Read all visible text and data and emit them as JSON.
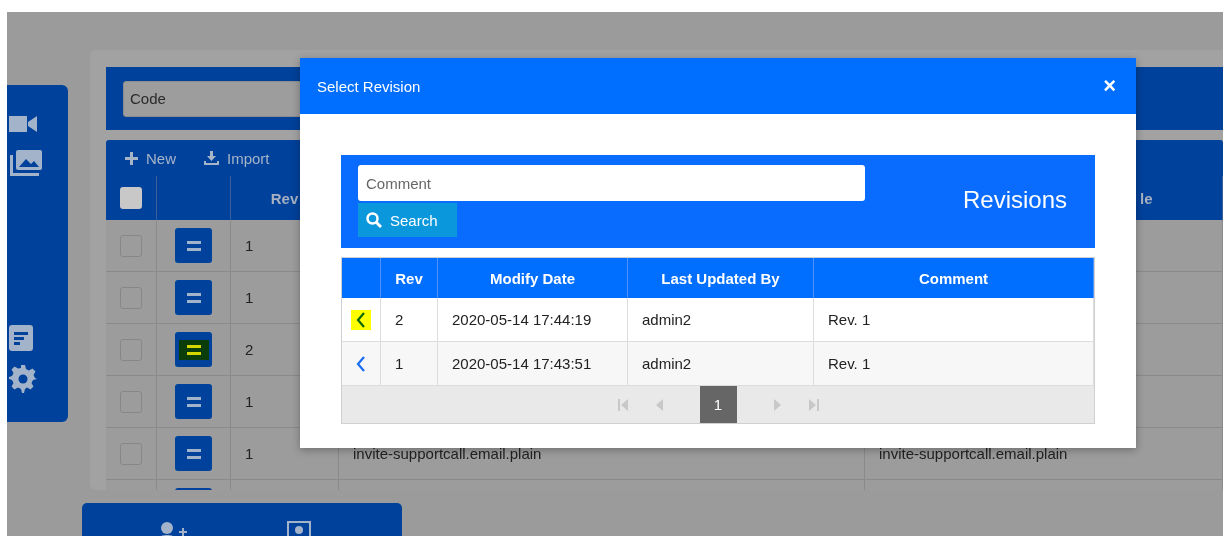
{
  "filter": {
    "code_placeholder": "Code"
  },
  "toolbar": {
    "buttons": [
      {
        "label": "New",
        "kind": "new"
      },
      {
        "label": "Import",
        "kind": "import"
      }
    ]
  },
  "table": {
    "all_checked": false,
    "columns": [
      "Rev",
      "le"
    ],
    "rows": [
      {
        "rev": "1",
        "highlighted": false,
        "checked": false
      },
      {
        "rev": "1",
        "highlighted": false,
        "checked": false
      },
      {
        "rev": "2",
        "highlighted": true,
        "checked": false
      },
      {
        "rev": "1",
        "highlighted": false,
        "checked": false
      },
      {
        "rev": "1",
        "highlighted": false,
        "checked": false,
        "code": "invite-supportcall.email.plain",
        "column_5": "invite-supportcall.email.plain"
      }
    ]
  },
  "dialog": {
    "title": "Select Revision",
    "close": "×",
    "search": {
      "placeholder": "Comment",
      "button": "Search",
      "heading": "Revisions"
    },
    "columns": [
      "Rev",
      "Modify Date",
      "Last Updated By",
      "Comment"
    ],
    "rows": [
      {
        "rev": "2",
        "modify_date": "2020-05-14 17:44:19",
        "last_updated_by": "admin2",
        "comment": "Rev. 1",
        "highlighted": true
      },
      {
        "rev": "1",
        "modify_date": "2020-05-14 17:43:51",
        "last_updated_by": "admin2",
        "comment": "Rev. 1",
        "highlighted": false
      }
    ],
    "pager": {
      "pages": [
        {
          "label": "1",
          "selected": true
        }
      ]
    }
  }
}
